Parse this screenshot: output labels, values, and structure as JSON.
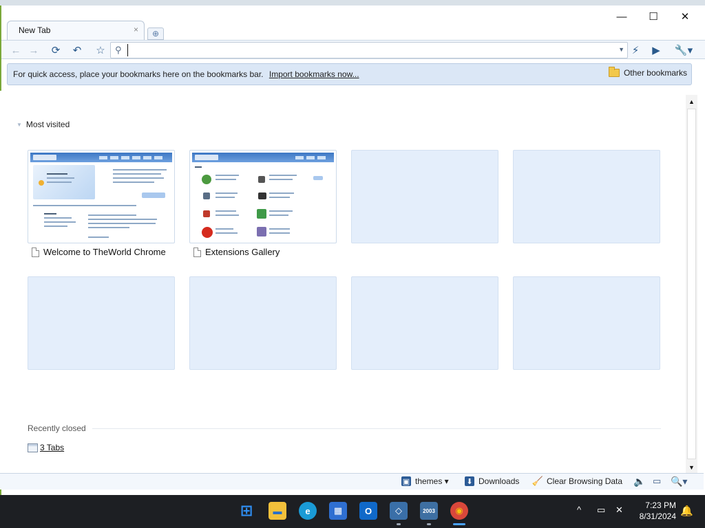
{
  "window": {
    "controls": {
      "minimize": "—",
      "maximize": "☐",
      "close": "✕"
    }
  },
  "tabs": [
    {
      "label": "New Tab",
      "close": "×"
    }
  ],
  "new_tab_glyph": "⊕",
  "toolbar": {
    "back": "←",
    "forward": "→",
    "reload": "⟳",
    "undo": "↶",
    "star": "☆",
    "search_glyph": "⚲",
    "omnibox_value": "",
    "omnibox_dropdown": "▼",
    "lightning": "⚡",
    "go": "▶",
    "wrench": "🔧▾"
  },
  "bookmarks_bar": {
    "hint": "For quick access, place your bookmarks here on the bookmarks bar.",
    "import_link": "Import bookmarks now...",
    "other_bookmarks": "Other bookmarks"
  },
  "most_visited": {
    "header": "Most visited",
    "collapse_glyph": "▼",
    "tiles": [
      {
        "title": "Welcome to TheWorld Chrome",
        "filled": true
      },
      {
        "title": "Extensions Gallery",
        "filled": true
      },
      {
        "title": "",
        "filled": false
      },
      {
        "title": "",
        "filled": false
      },
      {
        "title": "",
        "filled": false
      },
      {
        "title": "",
        "filled": false
      },
      {
        "title": "",
        "filled": false
      },
      {
        "title": "",
        "filled": false
      }
    ]
  },
  "recently_closed": {
    "header": "Recently closed",
    "item": "3 Tabs"
  },
  "scrollbar": {
    "up": "▲",
    "down": "▼"
  },
  "status_bar": {
    "themes": "themes ▾",
    "downloads": "Downloads",
    "clear_data": "Clear Browsing Data",
    "themes_glyph": "▣",
    "downloads_glyph": "⬇",
    "clear_glyph": "🧹",
    "sound_glyph": "🔈",
    "device_glyph": "▭",
    "zoom_glyph": "🔍▾"
  },
  "taskbar": {
    "apps": [
      {
        "name": "start",
        "glyph": "⊞",
        "color": "#2f8ef2"
      },
      {
        "name": "file-explorer",
        "glyph": "▬",
        "color": "#f2c03b"
      },
      {
        "name": "edge",
        "glyph": "e",
        "color": "#1a9bd6"
      },
      {
        "name": "store",
        "glyph": "▦",
        "color": "#2f6fd1"
      },
      {
        "name": "outlook",
        "glyph": "O",
        "color": "#1069c9"
      },
      {
        "name": "virtualbox",
        "glyph": "◇",
        "color": "#3a6fa8"
      },
      {
        "name": "server-2003",
        "glyph": "2003",
        "color": "#3e6fa2"
      },
      {
        "name": "chrome",
        "glyph": "◉",
        "color": "#d9473b"
      }
    ],
    "tray": {
      "chevron": "^",
      "network": "▭",
      "volume": "✕"
    },
    "time": "7:23 PM",
    "date": "8/31/2024",
    "bell": "🔔"
  },
  "colors": {
    "bookmarks_bar_bg": "#dbe7f6",
    "tile_bg": "#e4eefb",
    "accent": "#2c5b96"
  }
}
